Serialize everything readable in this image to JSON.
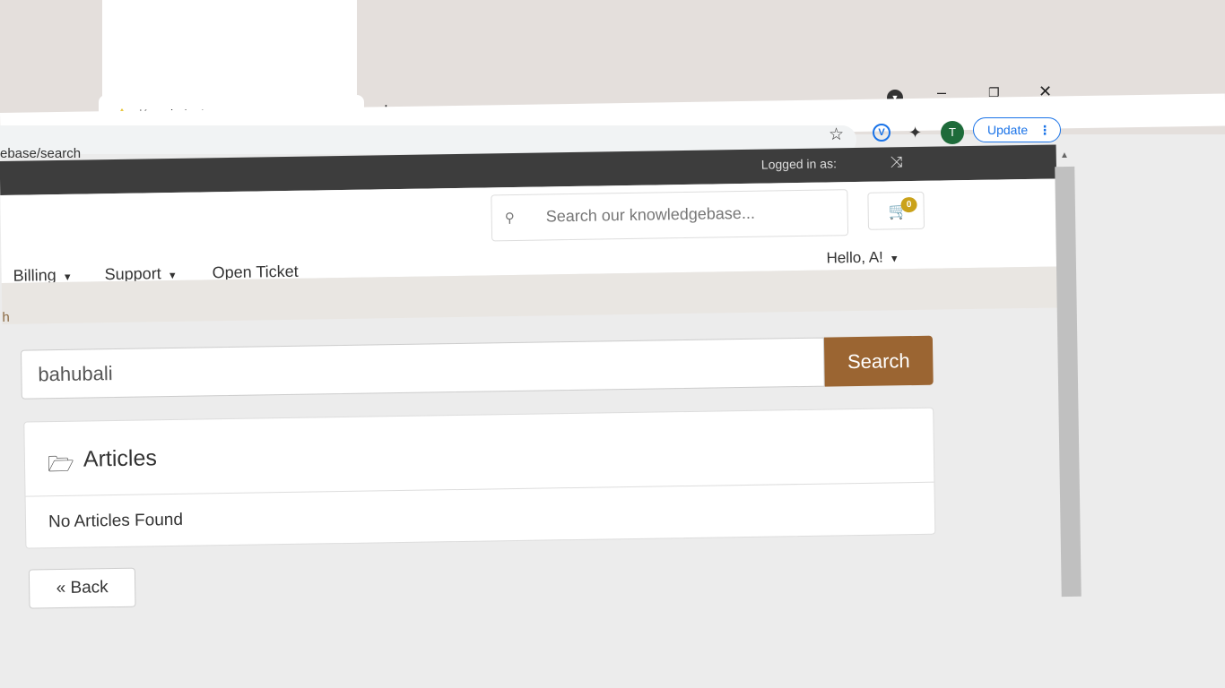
{
  "browser": {
    "tab_title": "Knowledgebase - Joy TV",
    "tab_close": "×",
    "new_tab": "+",
    "url": "ebase/search",
    "update_label": "Update",
    "avatar_letter": "T",
    "ext_letter": "V"
  },
  "site": {
    "logged_in_label": "Logged in as:",
    "header_search_placeholder": "Search our knowledgebase...",
    "cart_count": "0",
    "nav": {
      "billing": "Billing",
      "support": "Support",
      "open_ticket": "Open Ticket"
    },
    "greeting": "Hello, A!",
    "breadcrumb": "h"
  },
  "kb": {
    "query": "bahubali",
    "search_label": "Search",
    "panel_title": "Articles",
    "empty_message": "No Articles Found",
    "back_label": "« Back"
  },
  "colors": {
    "topbar": "#3d3d3d",
    "search_button": "#9b6532",
    "cart_badge": "#caa21a"
  }
}
